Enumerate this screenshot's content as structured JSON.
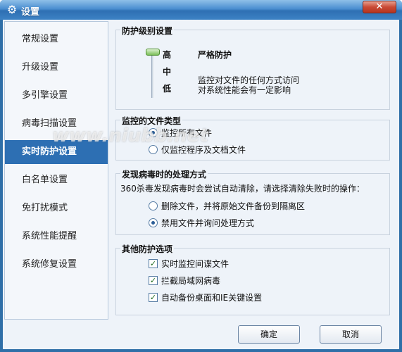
{
  "window": {
    "title": "设置",
    "close_label": "✕"
  },
  "sidebar": {
    "items": [
      {
        "label": "常规设置"
      },
      {
        "label": "升级设置"
      },
      {
        "label": "多引擎设置"
      },
      {
        "label": "病毒扫描设置"
      },
      {
        "label": "实时防护设置",
        "active": true
      },
      {
        "label": "白名单设置"
      },
      {
        "label": "免打扰模式"
      },
      {
        "label": "系统性能提醒"
      },
      {
        "label": "系统修复设置"
      }
    ]
  },
  "protection_level": {
    "title": "防护级别设置",
    "high": "高",
    "medium": "中",
    "low": "低",
    "current_name": "严格防护",
    "desc_line1": "监控对文件的任何方式访问",
    "desc_line2": "对系统性能会有一定影响",
    "level_fraction": 1.0
  },
  "monitor_files": {
    "title": "监控的文件类型",
    "options": [
      {
        "label": "监控所有文件",
        "selected": true
      },
      {
        "label": "仅监控程序及文档文件",
        "selected": false
      }
    ]
  },
  "virus_action": {
    "title": "发现病毒时的处理方式",
    "instruction": "360杀毒发现病毒时会尝试自动清除，请选择清除失败时的操作：",
    "options": [
      {
        "label": "删除文件，并将原始文件备份到隔离区",
        "selected": false
      },
      {
        "label": "禁用文件并询问处理方式",
        "selected": true
      }
    ]
  },
  "other": {
    "title": "其他防护选项",
    "options": [
      {
        "label": "实时监控间谍文件",
        "checked": true
      },
      {
        "label": "拦截局域网病毒",
        "checked": true
      },
      {
        "label": "自动备份桌面和IE关键设置",
        "checked": true
      }
    ]
  },
  "buttons": {
    "ok": "确定",
    "cancel": "取消"
  },
  "watermark": "www.niubb.net",
  "colors": {
    "accent": "#2d6fb3",
    "titlebar": "#3d82c4"
  },
  "icons": {
    "title": "gear-icon"
  }
}
